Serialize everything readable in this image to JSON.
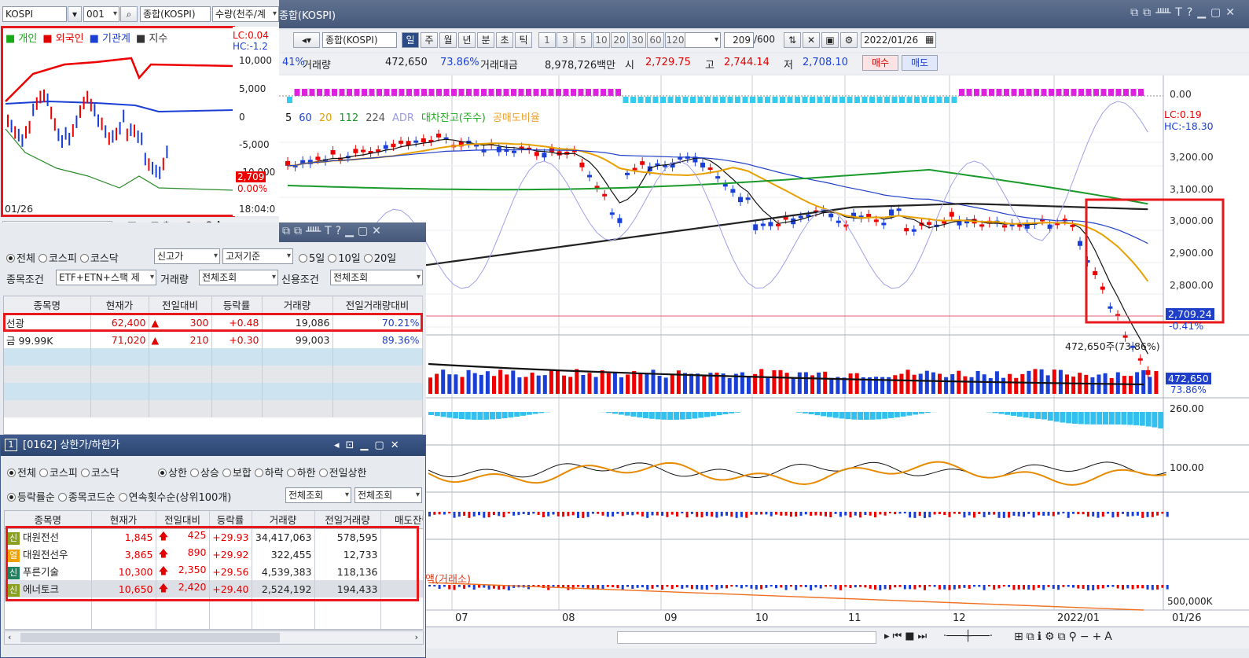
{
  "main_chart": {
    "title": "종합(KOSPI)",
    "symbol": "종합(KOSPI)",
    "periods": [
      "일",
      "주",
      "월",
      "년",
      "분",
      "초",
      "틱"
    ],
    "minute_units": [
      "1",
      "3",
      "5",
      "10",
      "20",
      "30",
      "60",
      "120"
    ],
    "count": "209",
    "count_max": "/600",
    "date": "2022/01/26",
    "info_pct": "41%",
    "volume_label": "거래량",
    "volume": "472,650",
    "volume_pct": "73.86%",
    "amount_label": "거래대금",
    "amount": "8,978,726백만",
    "open_label": "시",
    "open": "2,729.75",
    "high_label": "고",
    "high": "2,744.14",
    "low_label": "저",
    "low": "2,708.10",
    "buy": "매수",
    "sell": "매도",
    "ma_labels": [
      {
        "text": "5",
        "color": "#111111"
      },
      {
        "text": "60",
        "color": "#1f3fc8"
      },
      {
        "text": "20",
        "color": "#e8a000"
      },
      {
        "text": "112",
        "color": "#1a9a2a"
      },
      {
        "text": "224",
        "color": "#555555"
      },
      {
        "text": "ADR",
        "color": "#9a9ae0"
      },
      {
        "text": "대차잔고(주수)",
        "color": "#18a818"
      },
      {
        "text": "공매도비율",
        "color": "#f0a030"
      }
    ],
    "lc": "LC:0.19",
    "hc": "HC:-18.30",
    "y_labels": [
      "0.00",
      "3,200.00",
      "3,100.00",
      "3,000.00",
      "2,900.00",
      "2,800.00"
    ],
    "price_tag": "2,709.24",
    "price_tag_pct": "-0.41%",
    "volume_caption": "472,650주(73.86%)",
    "volume_tag": "472,650",
    "volume_tag_pct": "73.86%",
    "ind_label_1": "260.00",
    "ind_label_2": "100.00",
    "ind_label_3": "500,000K",
    "ind_caption": "액(거래소)",
    "months": [
      "07",
      "08",
      "09",
      "10",
      "11",
      "12",
      "2022/01"
    ],
    "end_date": "01/26"
  },
  "mini_chart": {
    "market": "KOSPI",
    "code": "001",
    "name": "종합(KOSPI)",
    "unit": "수량(천주/계",
    "legend": [
      {
        "text": "개인",
        "color": "#18a818"
      },
      {
        "text": "외국인",
        "color": "#e00000"
      },
      {
        "text": "기관계",
        "color": "#1a3fd6"
      },
      {
        "text": "지수",
        "color": "#333333"
      }
    ],
    "lc": "LC:0.04",
    "hc": "HC:-1.2",
    "y_labels": [
      "10,000",
      "5,000",
      "0",
      "-5,000",
      "-10,000"
    ],
    "price_tag": "2,709",
    "price_pct": "0.00%",
    "date": "01/26",
    "time": "18:04:0"
  },
  "screener": {
    "radios": [
      "전체",
      "코스피",
      "코스닥"
    ],
    "filter": "신고가",
    "basis": "고저기준",
    "days": [
      "5일",
      "10일",
      "20일"
    ],
    "cond_label": "종목조건",
    "cond_value": "ETF+ETN+스팩 제",
    "vol_label": "거래량",
    "vol_value": "전체조회",
    "credit_label": "신용조건",
    "credit_value": "전체조회",
    "headers": [
      "종목명",
      "현재가",
      "전일대비",
      "등락률",
      "거래량",
      "전일거래량대비"
    ],
    "rows": [
      {
        "name": "선광",
        "price": "62,400",
        "arrow": "▲",
        "change": "300",
        "rate": "+0.48",
        "volume": "19,086",
        "ratio": "70.21%"
      },
      {
        "name": "금 99.99K",
        "price": "71,020",
        "arrow": "▲",
        "change": "210",
        "rate": "+0.30",
        "volume": "99,003",
        "ratio": "89.36%"
      }
    ]
  },
  "limit_window": {
    "title": "[0162] 상한가/하한가",
    "radios": [
      "전체",
      "코스피",
      "코스닥"
    ],
    "types": [
      "상한",
      "상승",
      "보합",
      "하락",
      "하한",
      "전일상한"
    ],
    "sorts": [
      "등락률순",
      "종목코드순",
      "연속횟수순(상위100개)"
    ],
    "sel1": "전체조회",
    "sel2": "전체조회",
    "headers": [
      "종목명",
      "현재가",
      "전일대비",
      "등락률",
      "거래량",
      "전일거래량",
      "매도잔량"
    ],
    "rows": [
      {
        "tag": "신",
        "tag_color": "#8aa020",
        "name": "대원전선",
        "price": "1,845",
        "arrow": "🡅",
        "change": "425",
        "rate": "+29.93",
        "volume": "34,417,063",
        "prev": "578,595"
      },
      {
        "tag": "열",
        "tag_color": "#f0a000",
        "name": "대원전선우",
        "price": "3,865",
        "arrow": "🡅",
        "change": "890",
        "rate": "+29.92",
        "volume": "322,455",
        "prev": "12,733"
      },
      {
        "tag": "신",
        "tag_color": "#208060",
        "name": "푸른기술",
        "price": "10,300",
        "arrow": "🡅",
        "change": "2,350",
        "rate": "+29.56",
        "volume": "4,539,383",
        "prev": "118,136"
      },
      {
        "tag": "신",
        "tag_color": "#8aa020",
        "name": "에너토크",
        "price": "10,650",
        "arrow": "🡅",
        "change": "2,420",
        "rate": "+29.40",
        "volume": "2,524,192",
        "prev": "194,433"
      }
    ]
  }
}
